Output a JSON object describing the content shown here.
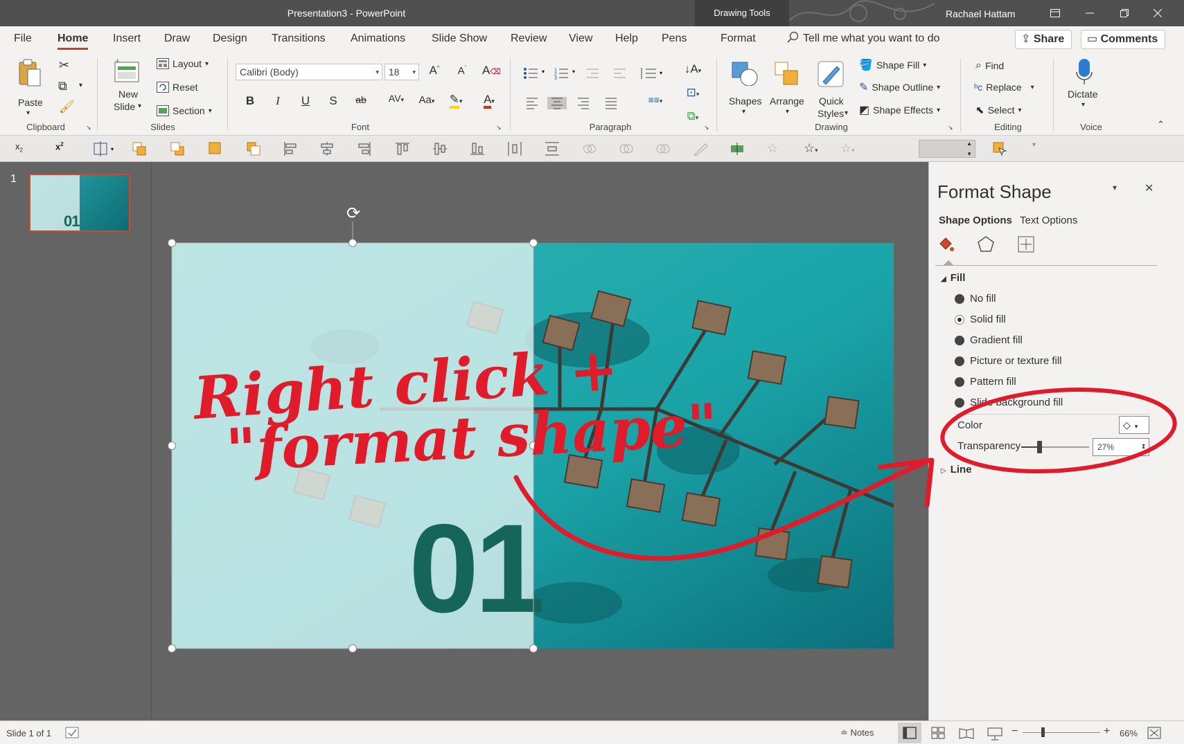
{
  "window": {
    "title": "Presentation3  -  PowerPoint",
    "context_tab": "Drawing Tools",
    "user": "Rachael Hattam"
  },
  "tabs": [
    "File",
    "Home",
    "Insert",
    "Draw",
    "Design",
    "Transitions",
    "Animations",
    "Slide Show",
    "Review",
    "View",
    "Help",
    "Pens",
    "Format"
  ],
  "tell_me": "Tell me what you want to do",
  "share_label": "Share",
  "comments_label": "Comments",
  "ribbon": {
    "clipboard": {
      "paste": "Paste",
      "group": "Clipboard"
    },
    "slides": {
      "new_slide_1": "New",
      "new_slide_2": "Slide",
      "layout": "Layout",
      "reset": "Reset",
      "section": "Section",
      "group": "Slides"
    },
    "font": {
      "family": "Calibri (Body)",
      "size": "18",
      "group": "Font"
    },
    "paragraph": {
      "group": "Paragraph"
    },
    "drawing": {
      "shapes": "Shapes",
      "arrange": "Arrange",
      "quick_styles_1": "Quick",
      "quick_styles_2": "Styles",
      "shape_fill": "Shape Fill",
      "shape_outline": "Shape Outline",
      "shape_effects": "Shape Effects",
      "group": "Drawing"
    },
    "editing": {
      "find": "Find",
      "replace": "Replace",
      "select": "Select",
      "group": "Editing"
    },
    "voice": {
      "dictate": "Dictate",
      "group": "Voice"
    }
  },
  "thumbnail": {
    "index": "1",
    "number": "01"
  },
  "slide": {
    "number_text": "01",
    "annotation_line1": "Right click +",
    "annotation_line2": "\"format shape\""
  },
  "format_pane": {
    "title": "Format Shape",
    "tab_shape_options": "Shape Options",
    "tab_text_options": "Text Options",
    "fill_header": "Fill",
    "fill_options": [
      {
        "label": "No fill",
        "selected": false
      },
      {
        "label": "Solid fill",
        "selected": true
      },
      {
        "label": "Gradient fill",
        "selected": false
      },
      {
        "label": "Picture or texture fill",
        "selected": false
      },
      {
        "label": "Pattern fill",
        "selected": false
      },
      {
        "label": "Slide background fill",
        "selected": false
      }
    ],
    "color_label": "Color",
    "transparency_label": "Transparency",
    "transparency_value": "27%",
    "transparency_fraction": 0.27,
    "line_header": "Line"
  },
  "status": {
    "slide_info": "Slide 1 of 1",
    "notes": "Notes",
    "zoom": "66%"
  },
  "colors": {
    "accent": "#b7472a",
    "annotation": "#e01b2a",
    "water": "#1aa4a8",
    "number": "#15655a"
  }
}
